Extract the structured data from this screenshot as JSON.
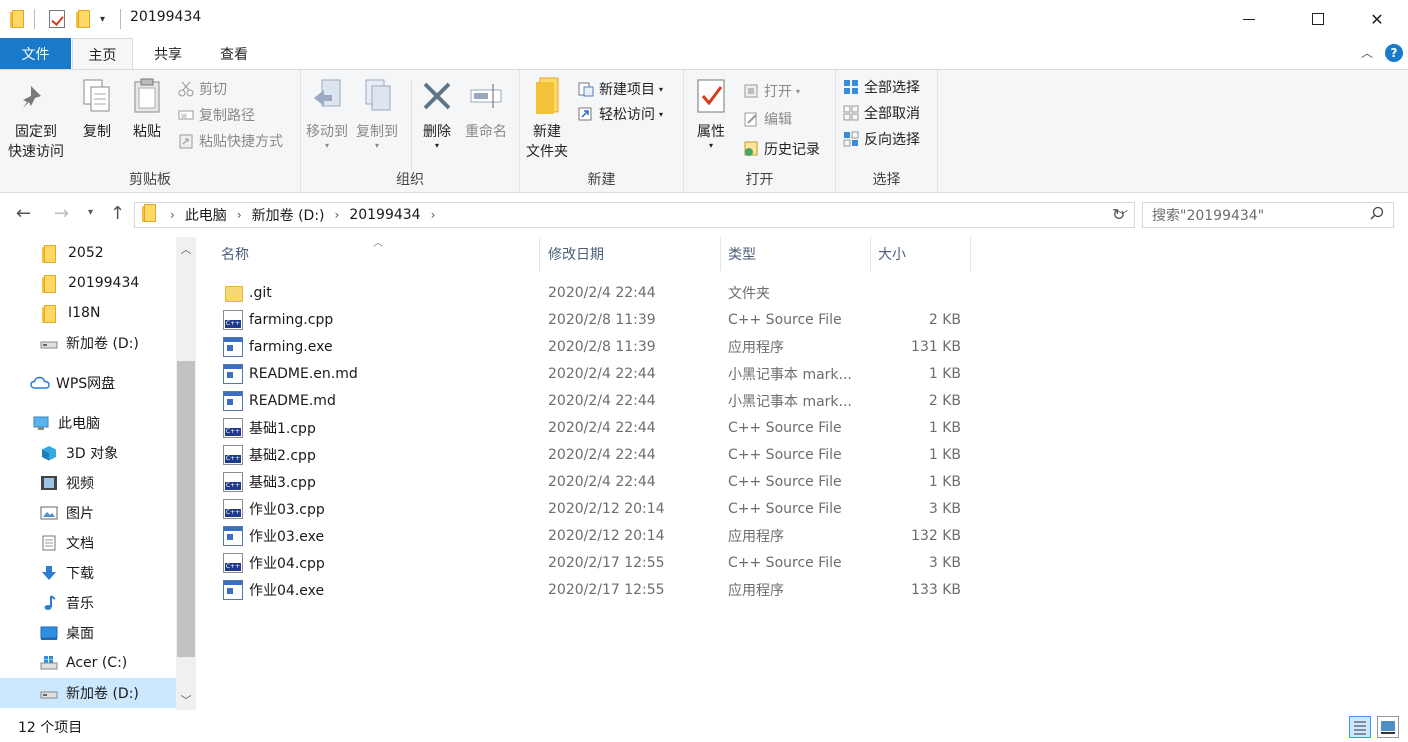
{
  "window": {
    "title": "20199434",
    "minimize": "–",
    "close": "✕"
  },
  "tabs": [
    "文件",
    "主页",
    "共享",
    "查看"
  ],
  "ribbon": {
    "clipboard": {
      "label": "剪贴板",
      "pin": [
        "固定到",
        "快速访问"
      ],
      "copy": "复制",
      "paste": "粘贴",
      "cut": "剪切",
      "copy_path": "复制路径",
      "paste_shortcut": "粘贴快捷方式"
    },
    "organize": {
      "label": "组织",
      "move_to": "移动到",
      "copy_to": "复制到",
      "delete": "删除",
      "rename": "重命名"
    },
    "new": {
      "label": "新建",
      "new_folder": [
        "新建",
        "文件夹"
      ],
      "new_item": "新建项目",
      "easy_access": "轻松访问"
    },
    "open": {
      "label": "打开",
      "properties": "属性",
      "open": "打开",
      "edit": "编辑",
      "history": "历史记录"
    },
    "select": {
      "label": "选择",
      "select_all": "全部选择",
      "select_none": "全部取消",
      "invert": "反向选择"
    }
  },
  "address": {
    "crumbs": [
      "此电脑",
      "新加卷 (D:)",
      "20199434"
    ],
    "search_placeholder": "搜索\"20199434\""
  },
  "nav": [
    {
      "label": "2052",
      "icon": "folder-icon"
    },
    {
      "label": "20199434",
      "icon": "folder-icon"
    },
    {
      "label": "I18N",
      "icon": "folder-icon"
    },
    {
      "label": "新加卷 (D:)",
      "icon": "drive-icon"
    },
    {
      "label": "WPS网盘",
      "icon": "cloud-icon"
    },
    {
      "label": "此电脑",
      "icon": "computer-icon"
    },
    {
      "label": "3D 对象",
      "icon": "3d-objects-icon"
    },
    {
      "label": "视频",
      "icon": "video-icon"
    },
    {
      "label": "图片",
      "icon": "pictures-icon"
    },
    {
      "label": "文档",
      "icon": "documents-icon"
    },
    {
      "label": "下载",
      "icon": "download-icon"
    },
    {
      "label": "音乐",
      "icon": "music-icon"
    },
    {
      "label": "桌面",
      "icon": "desktop-icon"
    },
    {
      "label": "Acer (C:)",
      "icon": "windows-drive-icon"
    },
    {
      "label": "新加卷 (D:)",
      "icon": "drive-icon"
    }
  ],
  "columns": {
    "name": "名称",
    "date": "修改日期",
    "type": "类型",
    "size": "大小"
  },
  "files": [
    {
      "name": ".git",
      "date": "2020/2/4 22:44",
      "type": "文件夹",
      "size": "",
      "icon": "folder-icon"
    },
    {
      "name": "farming.cpp",
      "date": "2020/2/8 11:39",
      "type": "C++ Source File",
      "size": "2 KB",
      "icon": "cpp-file-icon"
    },
    {
      "name": "farming.exe",
      "date": "2020/2/8 11:39",
      "type": "应用程序",
      "size": "131 KB",
      "icon": "exe-file-icon"
    },
    {
      "name": "README.en.md",
      "date": "2020/2/4 22:44",
      "type": "小黑记事本 mark...",
      "size": "1 KB",
      "icon": "md-file-icon"
    },
    {
      "name": "README.md",
      "date": "2020/2/4 22:44",
      "type": "小黑记事本 mark...",
      "size": "2 KB",
      "icon": "md-file-icon"
    },
    {
      "name": "基础1.cpp",
      "date": "2020/2/4 22:44",
      "type": "C++ Source File",
      "size": "1 KB",
      "icon": "cpp-file-icon"
    },
    {
      "name": "基础2.cpp",
      "date": "2020/2/4 22:44",
      "type": "C++ Source File",
      "size": "1 KB",
      "icon": "cpp-file-icon"
    },
    {
      "name": "基础3.cpp",
      "date": "2020/2/4 22:44",
      "type": "C++ Source File",
      "size": "1 KB",
      "icon": "cpp-file-icon"
    },
    {
      "name": "作业03.cpp",
      "date": "2020/2/12 20:14",
      "type": "C++ Source File",
      "size": "3 KB",
      "icon": "cpp-file-icon"
    },
    {
      "name": "作业03.exe",
      "date": "2020/2/12 20:14",
      "type": "应用程序",
      "size": "132 KB",
      "icon": "exe-file-icon"
    },
    {
      "name": "作业04.cpp",
      "date": "2020/2/17 12:55",
      "type": "C++ Source File",
      "size": "3 KB",
      "icon": "cpp-file-icon"
    },
    {
      "name": "作业04.exe",
      "date": "2020/2/17 12:55",
      "type": "应用程序",
      "size": "133 KB",
      "icon": "exe-file-icon"
    }
  ],
  "status": {
    "count": "12 个项目"
  },
  "colors": {
    "accent": "#1979ca",
    "selection": "#cce8ff",
    "ribbon_bg": "#f5f6f7"
  }
}
